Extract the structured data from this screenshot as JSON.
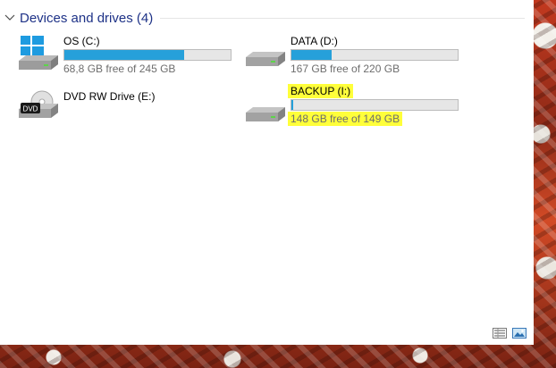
{
  "group": {
    "title": "Devices and drives (4)"
  },
  "drives": [
    {
      "name": "OS (C:)",
      "free_text": "68,8 GB free of 245 GB",
      "used_fraction": 0.72,
      "icon": "windows-drive-icon"
    },
    {
      "name": "DATA (D:)",
      "free_text": "167 GB free of 220 GB",
      "used_fraction": 0.24,
      "icon": "hard-drive-icon"
    },
    {
      "name": "DVD RW Drive (E:)",
      "icon": "dvd-drive-icon",
      "badge": "DVD"
    },
    {
      "name": "BACKUP (I:)",
      "free_text": "148 GB free of 149 GB",
      "used_fraction": 0.01,
      "icon": "hard-drive-icon",
      "highlight_color": "#ffff3a"
    }
  ],
  "colors": {
    "accent": "#26a0da",
    "group_title": "#1e3287",
    "highlight": "#ffff3a"
  },
  "view_buttons": [
    "details-view-icon",
    "large-icons-view-icon"
  ]
}
